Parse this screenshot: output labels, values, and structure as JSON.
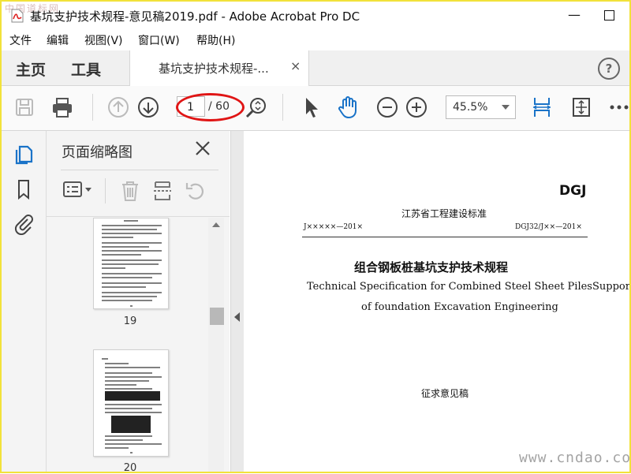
{
  "window": {
    "title": "基坑支护技术规程-意见稿2019.pdf - Adobe Acrobat Pro DC",
    "minimize_glyph": "—",
    "watermark_top": "中国道标网"
  },
  "menu": [
    "文件",
    "编辑",
    "视图(V)",
    "窗口(W)",
    "帮助(H)"
  ],
  "tabs": {
    "home": "主页",
    "tools": "工具",
    "document": "基坑支护技术规程-...",
    "close_glyph": "×",
    "help_glyph": "?"
  },
  "toolbar": {
    "current_page": "1",
    "total_pages": "/ 60",
    "zoom": "45.5%",
    "highlight_color": "#e01515",
    "accent": "#1a73c8"
  },
  "panel": {
    "title": "页面缩略图",
    "thumbnails": [
      {
        "label": "19"
      },
      {
        "label": "20"
      }
    ]
  },
  "document": {
    "code": "DGJ",
    "standard": "江苏省工程建设标准",
    "number_left": "J×××××—201×",
    "number_right": "DGJ32/J××—201×",
    "title_cn": "组合钢板桩基坑支护技术规程",
    "title_en_1": "Technical Specification for Combined Steel Sheet PilesSupport",
    "title_en_2": "of foundation Excavation Engineering",
    "draft": "征求意见稿"
  },
  "watermark_bottom": "www.cndao.com"
}
